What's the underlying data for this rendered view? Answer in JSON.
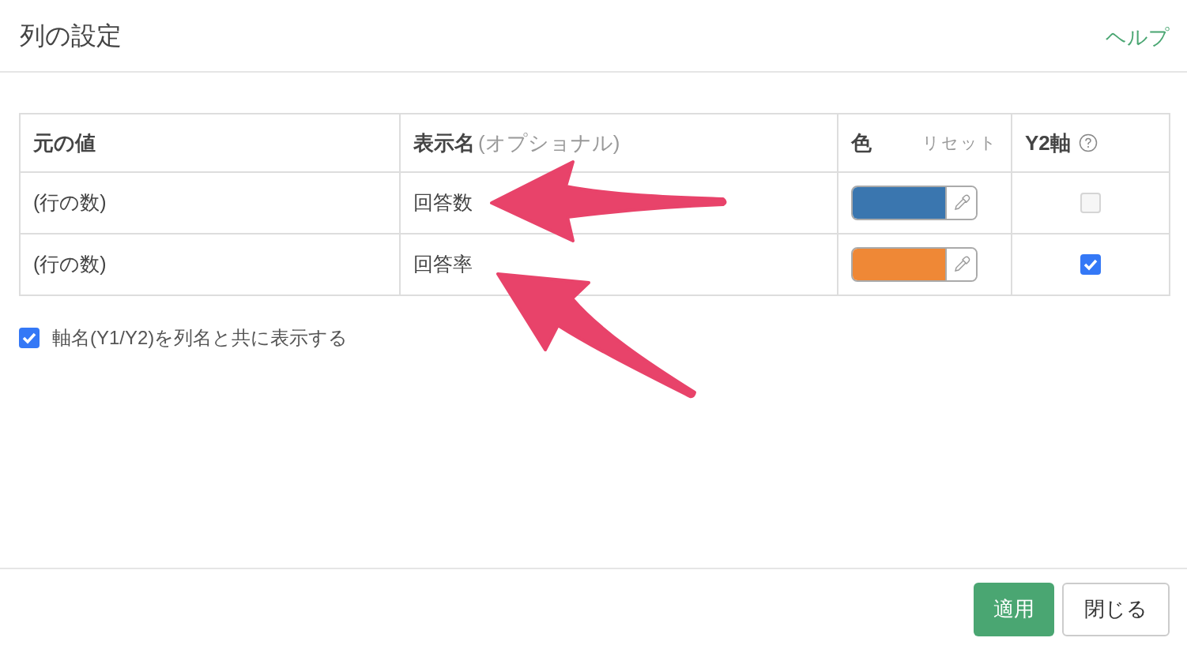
{
  "dialog": {
    "title": "列の設定",
    "help_link": "ヘルプ"
  },
  "table": {
    "columns": [
      {
        "label": "元の値"
      },
      {
        "label": "表示名",
        "hint": "(オプショナル)"
      },
      {
        "label": "色",
        "action": "リセット"
      },
      {
        "label": "Y2軸",
        "help": true
      }
    ],
    "rows": [
      {
        "source": "(行の数)",
        "display_name": "回答数",
        "color": "#3a76af",
        "y2": false
      },
      {
        "source": "(行の数)",
        "display_name": "回答率",
        "color": "#ef8836",
        "y2": true
      }
    ]
  },
  "option": {
    "label": "軸名(Y1/Y2)を列名と共に表示する",
    "checked": true
  },
  "buttons": [
    {
      "label": "適用",
      "kind": "primary"
    },
    {
      "label": "閉じる",
      "kind": "default"
    }
  ]
}
